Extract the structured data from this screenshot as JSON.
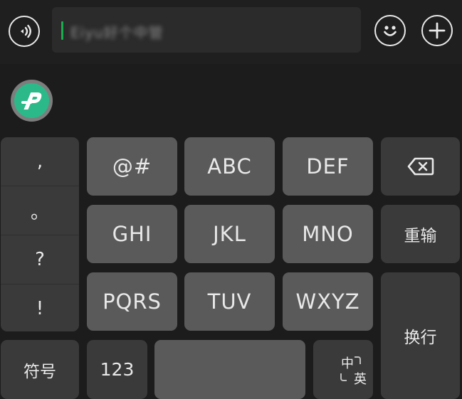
{
  "input": {
    "text": "Eiyu好个中管"
  },
  "keys": {
    "symbols": "@#",
    "abc": "ABC",
    "def": "DEF",
    "ghi": "GHI",
    "jkl": "JKL",
    "mno": "MNO",
    "pqrs": "PQRS",
    "tuv": "TUV",
    "wxyz": "WXYZ",
    "retype": "重输",
    "newline": "换行",
    "symbol_panel": "符号",
    "num": "123",
    "lang_zh": "中",
    "lang_en": "英"
  },
  "punctuation": [
    ",",
    "。",
    "?",
    "!"
  ],
  "icons": {
    "voice": "voice-wave-icon",
    "emoji": "smiley-icon",
    "plus": "plus-icon",
    "backspace": "backspace-icon",
    "logo": "p-logo-icon"
  },
  "colors": {
    "background": "#1c1c1c",
    "key_light": "#5a5a5a",
    "key_dark": "#3a3a3a",
    "cursor": "#1aad4e",
    "logo": "#2bb98a"
  }
}
